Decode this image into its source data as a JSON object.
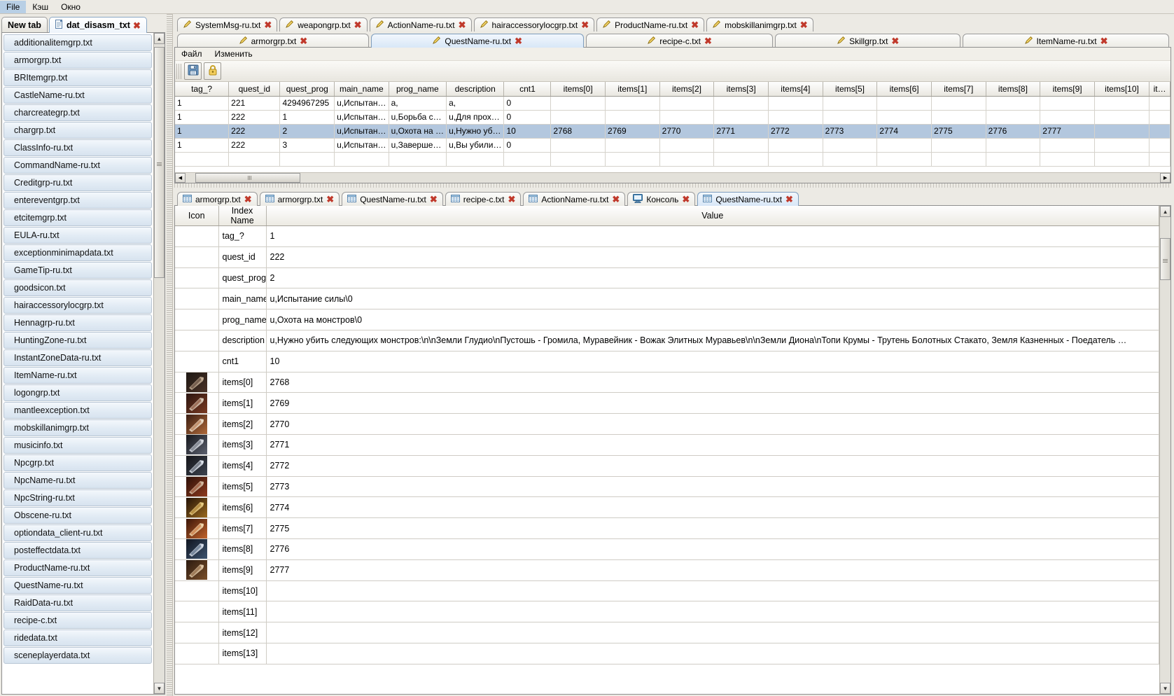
{
  "menubar": {
    "items": [
      "File",
      "Кэш",
      "Окно"
    ]
  },
  "sidebar": {
    "tabs": [
      {
        "label": "New tab",
        "active": false,
        "icon": ""
      },
      {
        "label": "dat_disasm_txt",
        "active": true,
        "icon": "document-icon",
        "close": "✖"
      }
    ],
    "files": [
      "additionalitemgrp.txt",
      "armorgrp.txt",
      "BRItemgrp.txt",
      "CastleName-ru.txt",
      "charcreategrp.txt",
      "chargrp.txt",
      "ClassInfo-ru.txt",
      "CommandName-ru.txt",
      "Creditgrp-ru.txt",
      "entereventgrp.txt",
      "etcitemgrp.txt",
      "EULA-ru.txt",
      "exceptionminimapdata.txt",
      "GameTip-ru.txt",
      "goodsicon.txt",
      "hairaccessorylocgrp.txt",
      "Hennagrp-ru.txt",
      "HuntingZone-ru.txt",
      "InstantZoneData-ru.txt",
      "ItemName-ru.txt",
      "logongrp.txt",
      "mantleexception.txt",
      "mobskillanimgrp.txt",
      "musicinfo.txt",
      "Npcgrp.txt",
      "NpcName-ru.txt",
      "NpcString-ru.txt",
      "Obscene-ru.txt",
      "optiondata_client-ru.txt",
      "posteffectdata.txt",
      "ProductName-ru.txt",
      "QuestName-ru.txt",
      "RaidData-ru.txt",
      "recipe-c.txt",
      "ridedata.txt",
      "sceneplayerdata.txt"
    ]
  },
  "editor": {
    "tabs_row1": [
      {
        "label": "SystemMsg-ru.txt",
        "active": false
      },
      {
        "label": "weapongrp.txt",
        "active": false
      },
      {
        "label": "ActionName-ru.txt",
        "active": false
      },
      {
        "label": "hairaccessorylocgrp.txt",
        "active": false
      },
      {
        "label": "ProductName-ru.txt",
        "active": false
      },
      {
        "label": "mobskillanimgrp.txt",
        "active": false
      }
    ],
    "tabs_row2": [
      {
        "label": "armorgrp.txt",
        "active": false
      },
      {
        "label": "QuestName-ru.txt",
        "active": true
      },
      {
        "label": "recipe-c.txt",
        "active": false
      },
      {
        "label": "Skillgrp.txt",
        "active": false
      },
      {
        "label": "ItemName-ru.txt",
        "active": false
      }
    ],
    "menu": [
      "Файл",
      "Изменить"
    ],
    "toolbar_buttons": [
      "save-icon",
      "lock-icon"
    ],
    "close_glyph": "✖"
  },
  "grid": {
    "columns": [
      "tag_?",
      "quest_id",
      "quest_prog",
      "main_name",
      "prog_name",
      "description",
      "cnt1",
      "items[0]",
      "items[1]",
      "items[2]",
      "items[3]",
      "items[4]",
      "items[5]",
      "items[6]",
      "items[7]",
      "items[8]",
      "items[9]",
      "items[10]",
      "it…"
    ],
    "rows": [
      {
        "selected": false,
        "cells": [
          "1",
          "221",
          "4294967295",
          "u,Испытан…",
          "a,",
          "a,",
          "0",
          "",
          "",
          "",
          "",
          "",
          "",
          "",
          "",
          "",
          "",
          "",
          ""
        ]
      },
      {
        "selected": false,
        "cells": [
          "1",
          "222",
          "1",
          "u,Испытан…",
          "u,Борьба с…",
          "u,Для прох…",
          "0",
          "",
          "",
          "",
          "",
          "",
          "",
          "",
          "",
          "",
          "",
          "",
          ""
        ]
      },
      {
        "selected": true,
        "cells": [
          "1",
          "222",
          "2",
          "u,Испытан…",
          "u,Охота на …",
          "u,Нужно уб…",
          "10",
          "2768",
          "2769",
          "2770",
          "2771",
          "2772",
          "2773",
          "2774",
          "2775",
          "2776",
          "2777",
          "",
          ""
        ]
      },
      {
        "selected": false,
        "cells": [
          "1",
          "222",
          "3",
          "u,Испытан…",
          "u,Заверше…",
          "u,Вы убили…",
          "0",
          "",
          "",
          "",
          "",
          "",
          "",
          "",
          "",
          "",
          "",
          "",
          ""
        ]
      }
    ]
  },
  "detail": {
    "tabs": [
      {
        "label": "armorgrp.txt",
        "active": false,
        "icon": "table-icon"
      },
      {
        "label": "armorgrp.txt",
        "active": false,
        "icon": "table-icon"
      },
      {
        "label": "QuestName-ru.txt",
        "active": false,
        "icon": "table-icon"
      },
      {
        "label": "recipe-c.txt",
        "active": false,
        "icon": "table-icon"
      },
      {
        "label": "ActionName-ru.txt",
        "active": false,
        "icon": "table-icon"
      },
      {
        "label": "Консоль",
        "active": false,
        "icon": "console-icon"
      },
      {
        "label": "QuestName-ru.txt",
        "active": true,
        "icon": "table-icon"
      }
    ],
    "columns": [
      "Icon",
      "Index Name",
      "Value"
    ],
    "rows": [
      {
        "name": "tag_?",
        "value": "1",
        "icon": null
      },
      {
        "name": "quest_id",
        "value": "222",
        "icon": null
      },
      {
        "name": "quest_prog",
        "value": "2",
        "icon": null
      },
      {
        "name": "main_name",
        "value": "u,Испытание силы\\0",
        "icon": null
      },
      {
        "name": "prog_name",
        "value": "u,Охота на монстров\\0",
        "icon": null
      },
      {
        "name": "description",
        "value": "u,Нужно убить следующих монстров:\\n\\nЗемли Глудио\\nПустошь - Громила, Муравейник - Вожак Элитных Муравьев\\n\\nЗемли Диона\\nТопи Крумы - Трутень Болотных Стакато, Земля Казненных - Поедатель …",
        "icon": null
      },
      {
        "name": "cnt1",
        "value": "10",
        "icon": null
      },
      {
        "name": "items[0]",
        "value": "2768",
        "icon": "item-icon-2768"
      },
      {
        "name": "items[1]",
        "value": "2769",
        "icon": "item-icon-2769"
      },
      {
        "name": "items[2]",
        "value": "2770",
        "icon": "item-icon-2770"
      },
      {
        "name": "items[3]",
        "value": "2771",
        "icon": "item-icon-2771"
      },
      {
        "name": "items[4]",
        "value": "2772",
        "icon": "item-icon-2772"
      },
      {
        "name": "items[5]",
        "value": "2773",
        "icon": "item-icon-2773"
      },
      {
        "name": "items[6]",
        "value": "2774",
        "icon": "item-icon-2774"
      },
      {
        "name": "items[7]",
        "value": "2775",
        "icon": "item-icon-2775"
      },
      {
        "name": "items[8]",
        "value": "2776",
        "icon": "item-icon-2776"
      },
      {
        "name": "items[9]",
        "value": "2777",
        "icon": "item-icon-2777"
      },
      {
        "name": "items[10]",
        "value": "",
        "icon": null
      },
      {
        "name": "items[11]",
        "value": "",
        "icon": null
      },
      {
        "name": "items[12]",
        "value": "",
        "icon": null
      },
      {
        "name": "items[13]",
        "value": "",
        "icon": null
      }
    ]
  },
  "colors": {
    "selection": "#b3c7de",
    "tab_active": "#d8e7f7",
    "close_red": "#c0392b",
    "list_item": "#dfe9f3"
  }
}
